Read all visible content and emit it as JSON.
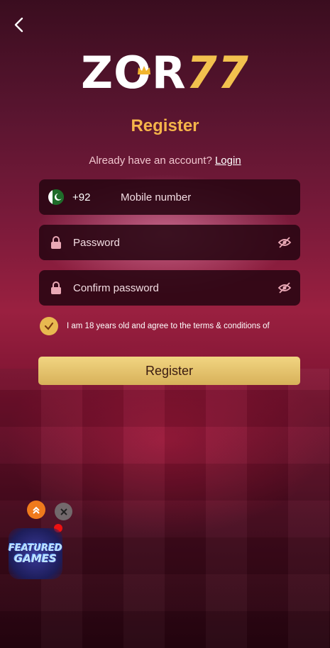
{
  "logo": {
    "part1": "ZOR",
    "part2": "77"
  },
  "page_title": "Register",
  "login_prompt": {
    "text": "Already have an account?",
    "link": "Login"
  },
  "fields": {
    "mobile": {
      "country_code": "+92",
      "placeholder": "Mobile number"
    },
    "password": {
      "placeholder": "Password"
    },
    "confirm_password": {
      "placeholder": "Confirm password"
    }
  },
  "terms_text": "I am 18 years old and agree to the terms & conditions of",
  "register_button": "Register",
  "featured_games": {
    "line1": "FEATURED",
    "line2": "GAMES"
  },
  "colors": {
    "accent": "#f5b54a",
    "button": "#e3c16e",
    "field_bg": "#28061a"
  }
}
